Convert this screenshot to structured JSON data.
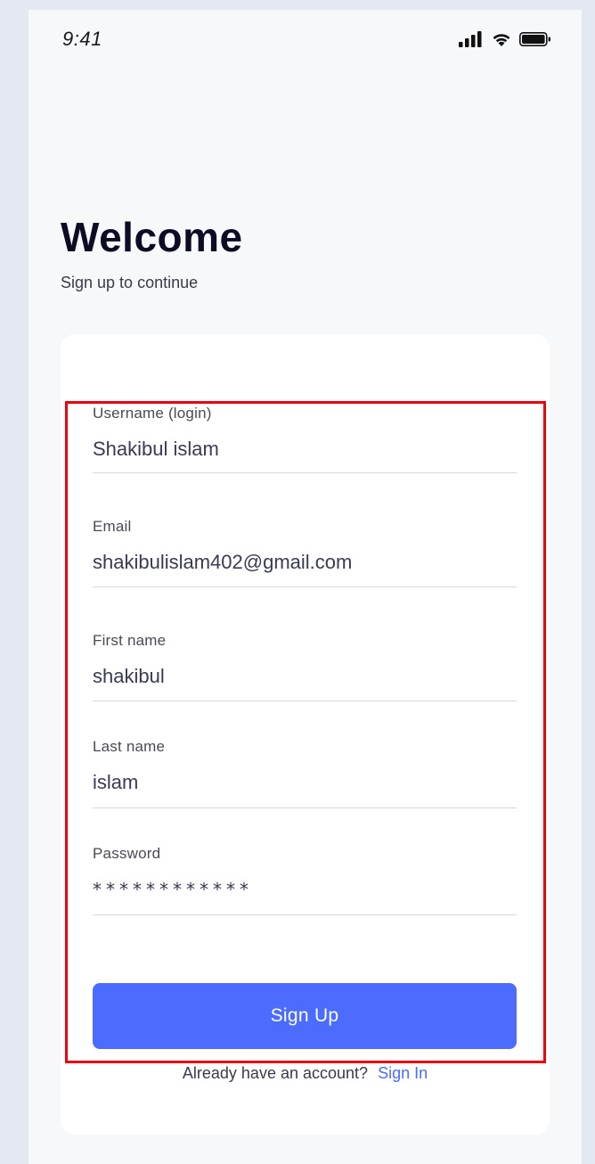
{
  "status_bar": {
    "time": "9:41",
    "icons": [
      "signal-icon",
      "wifi-icon",
      "battery-icon"
    ]
  },
  "header": {
    "title": "Welcome",
    "subtitle": "Sign up to continue"
  },
  "form": {
    "username": {
      "label": "Username (login)",
      "value": "Shakibul islam"
    },
    "email": {
      "label": "Email",
      "value": "shakibulislam402@gmail.com"
    },
    "first_name": {
      "label": "First name",
      "value": "shakibul"
    },
    "last_name": {
      "label": "Last name",
      "value": "islam"
    },
    "password": {
      "label": "Password",
      "masked_value": "************"
    },
    "submit_label": "Sign Up"
  },
  "footer": {
    "prompt": "Already have an account?",
    "link_label": "Sign In"
  },
  "colors": {
    "accent": "#4b6cff",
    "title": "#0e0b24",
    "highlight": "#e8000f"
  }
}
